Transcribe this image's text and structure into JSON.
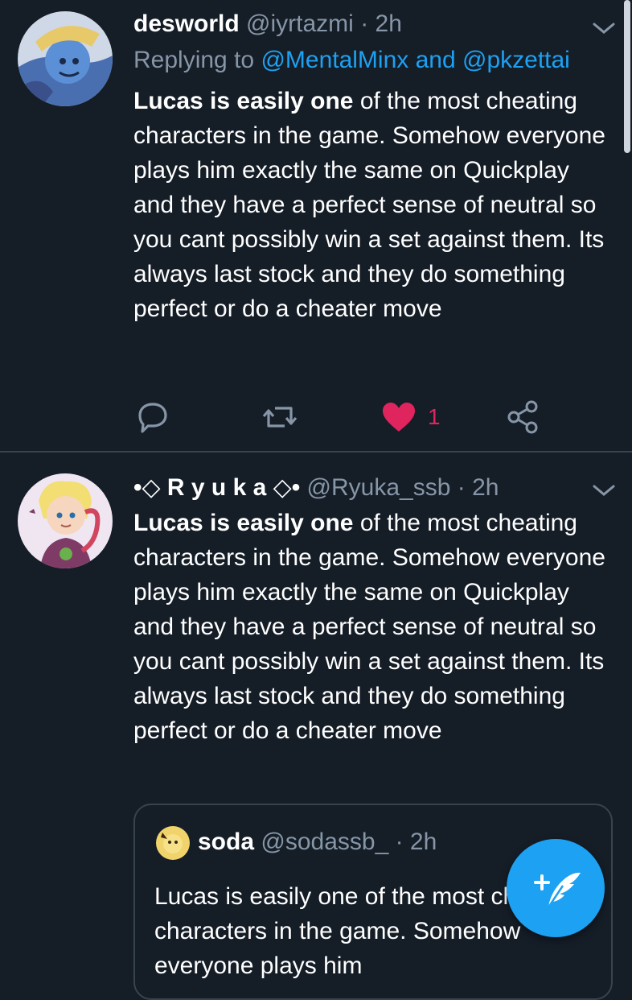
{
  "tweets": [
    {
      "display_name": "desworld",
      "handle": "@iyrtazmi",
      "time": "· 2h",
      "replying_prefix": "Replying to",
      "replying_mentions": "@MentalMinx and @pkzettai",
      "body_bold": "Lucas is easily one",
      "body_rest": " of the most cheating characters in the game. Somehow everyone plays him exactly the same on Quickplay and they have a perfect sense of neutral so you cant possibly win a set against them. Its always last stock and they do something perfect or do a cheater move",
      "like_count": "1",
      "liked": true
    },
    {
      "display_name": "•◇ R y u k a ◇•",
      "handle": "@Ryuka_ssb",
      "time": "· 2h",
      "body_bold": "Lucas is easily one",
      "body_rest": " of the most cheating characters in the game. Somehow everyone plays him exactly the same on Quickplay and they have a perfect sense of neutral so you cant possibly win a set against them. Its always last stock and they do something perfect or do a cheater move",
      "quote": {
        "display_name": "soda",
        "handle": "@sodassb_",
        "time": "· 2h",
        "body": "Lucas is easily one of the most cheating characters in the game. Somehow everyone plays him"
      }
    }
  ],
  "icons": {
    "reply": "reply-icon",
    "retweet": "retweet-icon",
    "like": "heart-icon",
    "share": "share-icon",
    "menu": "chevron-down-icon",
    "compose": "compose-tweet-icon"
  },
  "colors": {
    "background": "#151d27",
    "accent": "#1da1f2",
    "like": "#e0245e",
    "muted": "#8696a7",
    "divider": "#38444d"
  }
}
